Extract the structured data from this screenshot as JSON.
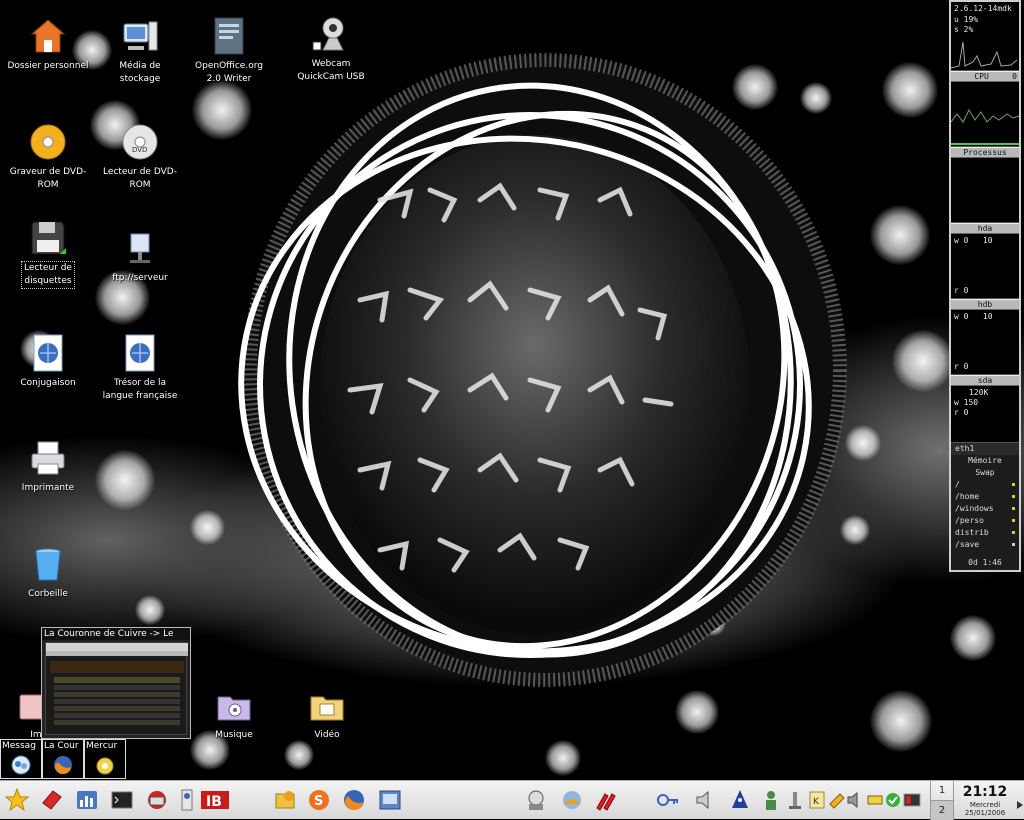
{
  "desktop": {
    "icons": [
      {
        "label": "Dossier personnel",
        "icon": "home-folder-icon"
      },
      {
        "label": "Média de\nstockage",
        "icon": "computer-icon"
      },
      {
        "label": "OpenOffice.org\n2.0 Writer",
        "icon": "writer-icon"
      },
      {
        "label": "Webcam\nQuickCam USB",
        "icon": "webcam-icon"
      },
      {
        "label": "Graveur de DVD-\nROM",
        "icon": "dvd-burner-icon"
      },
      {
        "label": "Lecteur de DVD-\nROM",
        "icon": "dvd-drive-icon"
      },
      {
        "label": "Lecteur de\ndisquettes",
        "icon": "floppy-icon"
      },
      {
        "label": "ftp://serveur",
        "icon": "ftp-server-icon"
      },
      {
        "label": "Conjugaison",
        "icon": "web-document-icon"
      },
      {
        "label": "Trésor de la\nlangue française",
        "icon": "web-document-icon"
      },
      {
        "label": "Imprimante",
        "icon": "printer-icon"
      },
      {
        "label": "Corbeille",
        "icon": "trash-icon"
      },
      {
        "label": "Im",
        "icon": "image-folder-icon"
      },
      {
        "label": "Musique",
        "icon": "music-folder-icon"
      },
      {
        "label": "Vidéo",
        "icon": "video-folder-icon"
      }
    ]
  },
  "gkrellm": {
    "kernel": "2.6.12-14mdk",
    "cpu_u": "u 19%",
    "cpu_s": "s 2%",
    "cpu_label": "CPU",
    "cpu_num": "0",
    "proc_label": "Processus",
    "hda_label": "hda",
    "hda_w": "w 0",
    "hda_w_val": "10",
    "hda_r": "r 0",
    "hdb_label": "hdb",
    "hdb_w": "w 0",
    "hdb_w_val": "10",
    "hdb_r": "r 0",
    "sda_label": "sda",
    "sda_val": "120K",
    "sda_w": "w 150",
    "sda_r": "r 0",
    "eth_label": "eth1",
    "mem_label": "Mémoire",
    "swap_label": "Swap",
    "fs": [
      "/",
      "/home",
      "/windows",
      "/perso",
      "distrib",
      "/save"
    ],
    "uptime": "0d 1:46"
  },
  "thumbnail": {
    "title": "La Couronne de Cuivre -> Le"
  },
  "tasks": [
    {
      "label": "Messag",
      "icon": "messenger-icon"
    },
    {
      "label": "La Cour",
      "icon": "firefox-icon"
    },
    {
      "label": "Mercur",
      "icon": "mercury-icon"
    }
  ],
  "panel": {
    "launchers": [
      "star-menu-icon",
      "eraser-icon",
      "kcontrol-icon",
      "terminal-icon",
      "network-icon",
      "kde-icon",
      "ib-icon",
      "kopete-icon",
      "skype-icon",
      "firefox-icon",
      "screenshot-icon",
      "konqueror-icon",
      "mozilla-icon",
      "paint-icon",
      "key-icon",
      "speaker-icon",
      "wizard-icon",
      "user-icon",
      "notification-icon",
      "klipper-icon",
      "volume-icon",
      "pencil-icon",
      "check-icon",
      "display-icon"
    ],
    "desktops": [
      "1",
      "2"
    ],
    "time": "21:12",
    "day": "Mercredi",
    "date": "25/01/2006"
  }
}
